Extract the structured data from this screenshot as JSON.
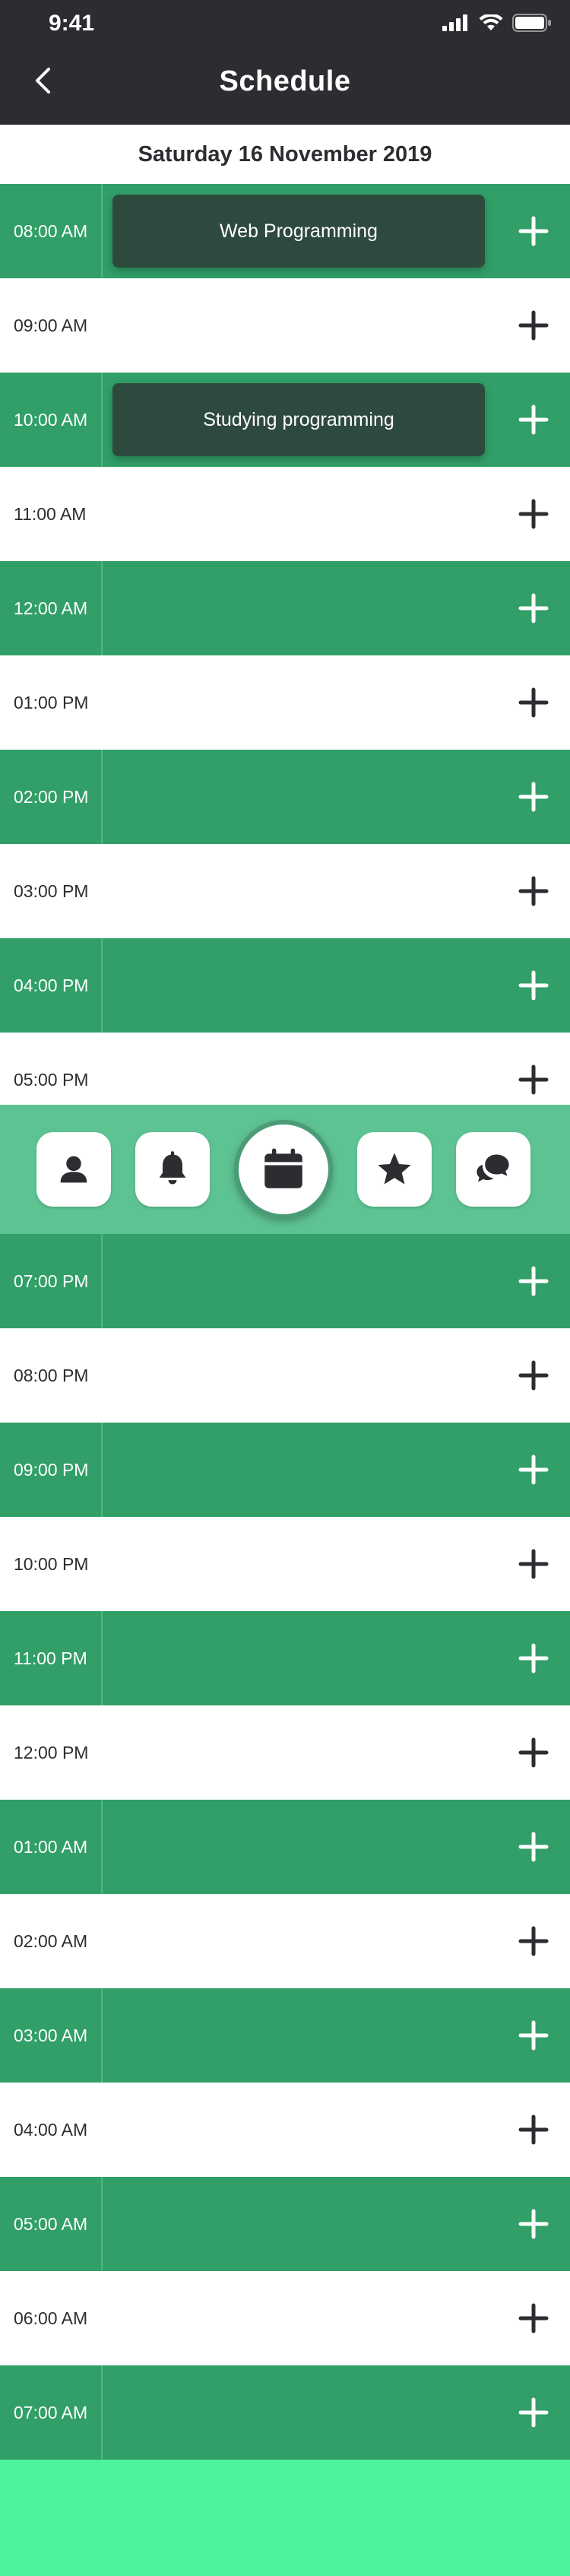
{
  "status_bar": {
    "time": "9:41"
  },
  "header": {
    "title": "Schedule",
    "back_icon": "chevron-left-icon"
  },
  "date_label": "Saturday 16 November 2019",
  "colors": {
    "header_bg": "#2e2c31",
    "row_green": "#319f67",
    "event_bg": "#2e4a3e",
    "tabbar_bg": "#5ec393",
    "footer_bg": "#4cf29c"
  },
  "slots": [
    {
      "time": "08:00 AM",
      "event": "Web Programming"
    },
    {
      "time": "09:00 AM"
    },
    {
      "time": "10:00 AM",
      "event": "Studying programming"
    },
    {
      "time": "11:00 AM"
    },
    {
      "time": "12:00 AM"
    },
    {
      "time": "01:00 PM"
    },
    {
      "time": "02:00 PM"
    },
    {
      "time": "03:00 PM"
    },
    {
      "time": "04:00 PM"
    },
    {
      "time": "05:00 PM"
    },
    {
      "time": "07:00 PM"
    },
    {
      "time": "08:00 PM"
    },
    {
      "time": "09:00 PM"
    },
    {
      "time": "10:00 PM"
    },
    {
      "time": "11:00 PM"
    },
    {
      "time": "12:00 PM"
    },
    {
      "time": "01:00 AM"
    },
    {
      "time": "02:00 AM"
    },
    {
      "time": "03:00 AM"
    },
    {
      "time": "04:00 AM"
    },
    {
      "time": "05:00 AM"
    },
    {
      "time": "06:00 AM"
    },
    {
      "time": "07:00 AM"
    }
  ],
  "tabs": [
    {
      "icon": "user-icon"
    },
    {
      "icon": "bell-icon"
    },
    {
      "icon": "calendar-icon",
      "active": true
    },
    {
      "icon": "star-icon"
    },
    {
      "icon": "chat-icon"
    }
  ]
}
